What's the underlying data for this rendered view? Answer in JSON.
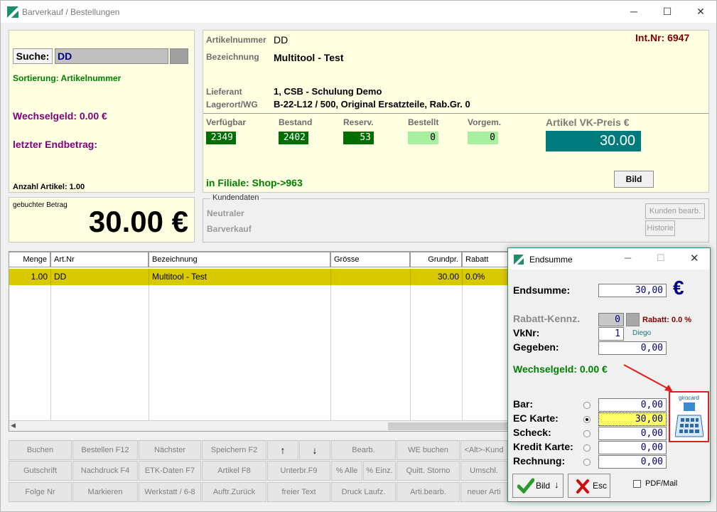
{
  "window": {
    "title": "Barverkauf / Bestellungen",
    "controls": {
      "minimize": "─",
      "maximize": "☐",
      "close": "✕"
    }
  },
  "left_panel": {
    "search_label": "Suche:",
    "search_value": "DD",
    "sort_text": "Sortierung: Artikelnummer",
    "change_text": "Wechselgeld: 0.00 €",
    "last_total_label": "letzter Endbetrag:",
    "article_count": "Anzahl Artikel: 1.00"
  },
  "booked": {
    "label": "gebuchter Betrag",
    "amount": "30.00 €"
  },
  "article": {
    "number_label": "Artikelnummer",
    "number": "DD",
    "int_nr": "Int.Nr: 6947",
    "name_label": "Bezeichnung",
    "name": "Multitool - Test",
    "supplier_label": "Lieferant",
    "supplier": "1, CSB - Schulung Demo",
    "storage_label": "Lagerort/WG",
    "storage": "B-22-L12 / 500, Original Ersatzteile, Rab.Gr. 0",
    "stock": [
      {
        "label": "Verfügbar",
        "value": "2349"
      },
      {
        "label": "Bestand",
        "value": "2402"
      },
      {
        "label": "Reserv.",
        "value": "53"
      },
      {
        "label": "Bestellt",
        "value": "0"
      },
      {
        "label": "Vorgem.",
        "value": "0"
      }
    ],
    "price_label": "Artikel VK-Preis €",
    "price": "30.00",
    "branch": "in Filiale: Shop->963",
    "image_button": "Bild"
  },
  "customer": {
    "legend": "Kundendaten",
    "line1": "Neutraler",
    "line2": "Barverkauf",
    "edit_button": "Kunden bearb.",
    "history_button": "Historie"
  },
  "grid": {
    "headers": [
      "Menge",
      "Art.Nr",
      "Bezeichnung",
      "Grösse",
      "Grundpr.",
      "Rabatt"
    ],
    "rows": [
      [
        "1.00",
        "DD",
        "Multitool - Test",
        "",
        "30.00",
        "0.0%"
      ]
    ]
  },
  "buttons": {
    "row1": [
      "Buchen",
      "Bestellen F12",
      "Nächster",
      "Speichern F2",
      "↑",
      "↓",
      "Bearb.",
      "WE buchen",
      "<Alt>-Kund"
    ],
    "row2": [
      "Gutschrift",
      "Nachdruck F4",
      "ETK-Daten F7",
      "Artikel F8",
      "Unterbr.F9",
      "% Alle",
      "% Einz.",
      "Quitt. Storno",
      "Umschl."
    ],
    "row3": [
      "Folge Nr",
      "Markieren",
      "Werkstatt / 6-8",
      "Auftr.Zurück",
      "freier Text",
      "Druck Laufz.",
      "Arti.bearb.",
      "neuer Arti"
    ]
  },
  "dialog": {
    "title": "Endsumme",
    "total_label": "Endsumme:",
    "total_value": "30,00",
    "currency": "€",
    "discount_label": "Rabatt-Kennz.",
    "discount_value": "0",
    "discount_text": "Rabatt: 0.0 %",
    "vknr_label": "VkNr:",
    "vknr_value": "1",
    "vknr_name": "Diego",
    "given_label": "Gegeben:",
    "given_value": "0,00",
    "change_text": "Wechselgeld: 0.00 €",
    "payments": [
      {
        "label": "Bar:",
        "value": "0,00",
        "selected": false
      },
      {
        "label": "EC Karte:",
        "value": "30,00",
        "selected": true
      },
      {
        "label": "Scheck:",
        "value": "0,00",
        "selected": false
      },
      {
        "label": "Kredit Karte:",
        "value": "0,00",
        "selected": false
      },
      {
        "label": "Rechnung:",
        "value": "0,00",
        "selected": false
      }
    ],
    "girocard_label": "girocard",
    "bild_button": "Bild",
    "esc_button": "Esc",
    "pdf_label": "PDF/Mail",
    "colors": {
      "accent": "#2a8f6a",
      "highlight": "#ffff66",
      "annotation": "#e02020"
    }
  }
}
